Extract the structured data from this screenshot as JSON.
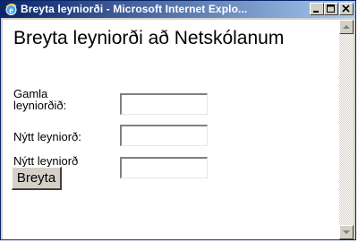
{
  "window": {
    "title": "Breyta leyniorði - Microsoft Internet Explo...",
    "icon": "ie-icon",
    "controls": [
      "minimize-icon",
      "maximize-icon",
      "close-icon"
    ]
  },
  "page": {
    "heading": "Breyta leyniorði að Netskólanum"
  },
  "form": {
    "old_password": {
      "label": "Gamla leyniorðið:",
      "value": ""
    },
    "new_password": {
      "label": "Nýtt leyniorð:",
      "value": ""
    },
    "new_password_again": {
      "label": "Nýtt leyniorð aftur:",
      "value": ""
    },
    "submit_label": "Breyta"
  },
  "colors": {
    "titlebar_start": "#0a246a",
    "titlebar_end": "#a6caf0",
    "chrome": "#d4d0c8"
  }
}
